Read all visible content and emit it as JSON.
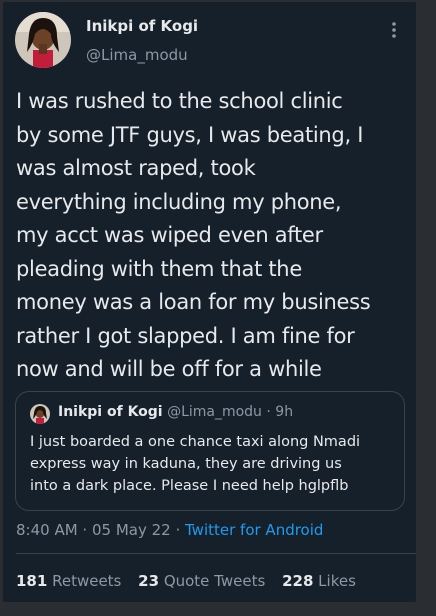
{
  "author": {
    "display_name": "Inikpi of Kogi",
    "handle": "@Lima_modu"
  },
  "tweet": {
    "text": "I was rushed to the school clinic\nby some JTF guys, I was beating, I\nwas almost raped, took\neverything including my phone,\nmy acct was wiped even after\npleading with them that the\nmoney was a loan for my business\nrather I got slapped. I am fine for\nnow and will be off for a while"
  },
  "quoted_tweet": {
    "display_name": "Inikpi of Kogi",
    "handle": "@Lima_modu",
    "dot": "·",
    "time": "9h",
    "text": "I just boarded a one chance taxi along Nmadi\nexpress way in kaduna, they are driving us\ninto a dark place. Please I need help hglpflb"
  },
  "meta": {
    "timestamp": "8:40 AM · 05 May 22",
    "separator": " · ",
    "source": "Twitter for Android"
  },
  "stats": {
    "retweets_count": "181",
    "retweets_label": "Retweets",
    "quote_tweets_count": "23",
    "quote_tweets_label": "Quote Tweets",
    "likes_count": "228",
    "likes_label": "Likes"
  },
  "colors": {
    "background": "#15202b",
    "text_primary": "#e7e9ea",
    "text_secondary": "#8b98a5",
    "accent": "#1d9bf0",
    "border": "#38444d"
  },
  "icons": {
    "more": "more-vertical-icon",
    "avatar": "profile-photo"
  }
}
